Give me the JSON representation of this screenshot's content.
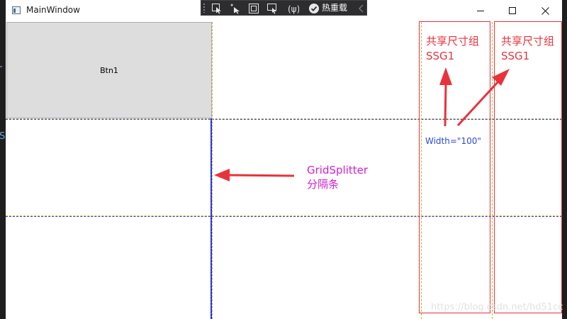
{
  "window": {
    "title": "MainWindow"
  },
  "debug_toolbar": {
    "hot_reload_label": "热重载",
    "icons": [
      "select-element-icon",
      "pointer-icon",
      "frame-icon",
      "display-adorners-icon",
      "track-focus-icon",
      "hot-reload-check-icon",
      "collapse-icon"
    ]
  },
  "content": {
    "button_label": "Btn1"
  },
  "annotations": {
    "shared_size_group_1_line1": "共享尺寸组",
    "shared_size_group_1_line2": "SSG1",
    "shared_size_group_2_line1": "共享尺寸组",
    "shared_size_group_2_line2": "SSG1",
    "width_label": "Width=\"100\"",
    "splitter_line1": "GridSplitter",
    "splitter_line2": "分隔条"
  },
  "watermark": "https://blog.csdn.net/hd51cc",
  "colors": {
    "annotation_red": "#e8333b",
    "annotation_magenta": "#d11fd1",
    "annotation_blue": "#2a4ad8",
    "splitter_blue": "#1f2bd6",
    "grid_line_dash": "#c8b23a",
    "button_bg": "#dddddd",
    "toolbar_bg": "#2d2d30"
  }
}
